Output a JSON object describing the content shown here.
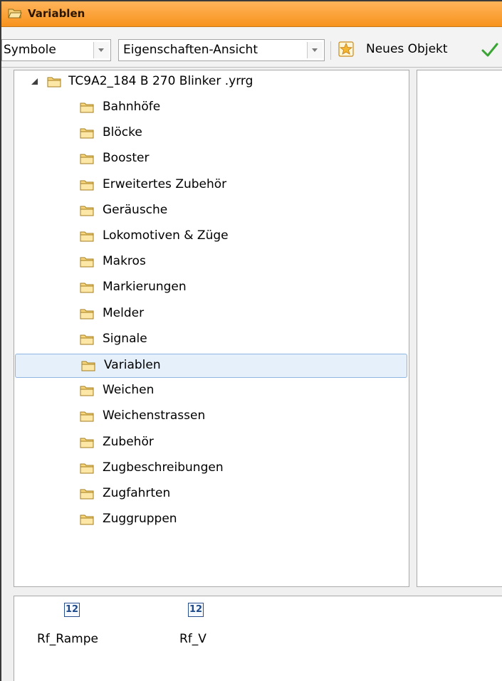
{
  "window": {
    "title": "Variablen",
    "title_icon": "folder-open-icon",
    "accent": "#f7931e"
  },
  "toolbar": {
    "view_combo": {
      "value": "Symbole"
    },
    "mode_combo": {
      "value": "Eigenschaften-Ansicht"
    },
    "new_object_label": "Neues Objekt",
    "new_object_icon": "star-icon",
    "confirm_icon": "checkmark-icon"
  },
  "tree": {
    "root": {
      "label": "TC9A2_184   B 270 Blinker    .yrrg",
      "expanded": true,
      "icon": "folder-icon"
    },
    "items": [
      {
        "label": "Bahnhöfe"
      },
      {
        "label": "Blöcke"
      },
      {
        "label": "Booster"
      },
      {
        "label": "Erweitertes Zubehör"
      },
      {
        "label": "Geräusche"
      },
      {
        "label": "Lokomotiven & Züge"
      },
      {
        "label": "Makros"
      },
      {
        "label": "Markierungen"
      },
      {
        "label": "Melder"
      },
      {
        "label": "Signale"
      },
      {
        "label": "Variablen",
        "selected": true
      },
      {
        "label": "Weichen"
      },
      {
        "label": "Weichenstrassen"
      },
      {
        "label": "Zubehör"
      },
      {
        "label": "Zugbeschreibungen"
      },
      {
        "label": "Zugfahrten"
      },
      {
        "label": "Zuggruppen"
      }
    ]
  },
  "variables": [
    {
      "badge": "12",
      "name": "Rf_Rampe"
    },
    {
      "badge": "12",
      "name": "Rf_V"
    }
  ]
}
